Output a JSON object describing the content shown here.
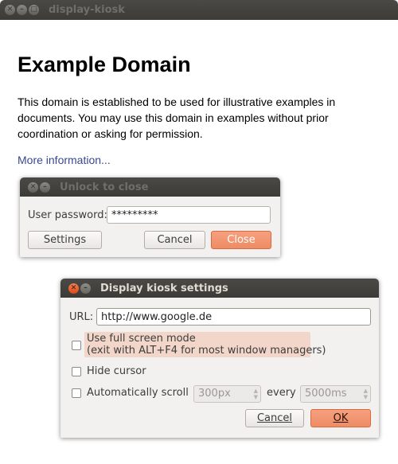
{
  "main_window": {
    "title": "display-kiosk",
    "page": {
      "heading": "Example Domain",
      "paragraph": "This domain is established to be used for illustrative examples in documents. You may use this domain in examples without prior coordination or asking for permission.",
      "link": "More information..."
    }
  },
  "unlock_dialog": {
    "title": "Unlock to close",
    "password_label": "User password:",
    "password_value": "*********",
    "settings_button": "Settings",
    "cancel_button": "Cancel",
    "close_button": "Close"
  },
  "settings_dialog": {
    "title": "Display kiosk settings",
    "url_label": "URL:",
    "url_value": "http://www.google.de",
    "fullscreen_label_line1": "Use full screen mode",
    "fullscreen_label_line2": "(exit with ALT+F4 for most window managers)",
    "hide_cursor_label": "Hide cursor",
    "autoscroll_label": "Automatically scroll",
    "scroll_amount": "300px",
    "every_label": "every",
    "scroll_interval": "5000ms",
    "cancel_button": "Cancel",
    "ok_button": "OK"
  },
  "icons": {
    "close": "close-icon",
    "minimize": "minimize-icon",
    "maximize": "maximize-icon",
    "spin_up": "spin-up-icon",
    "spin_down": "spin-down-icon"
  },
  "colors": {
    "titlebar": "#3c3b37",
    "accent": "#ee8c64",
    "highlight": "#f2d6c9",
    "link": "#38488f"
  }
}
